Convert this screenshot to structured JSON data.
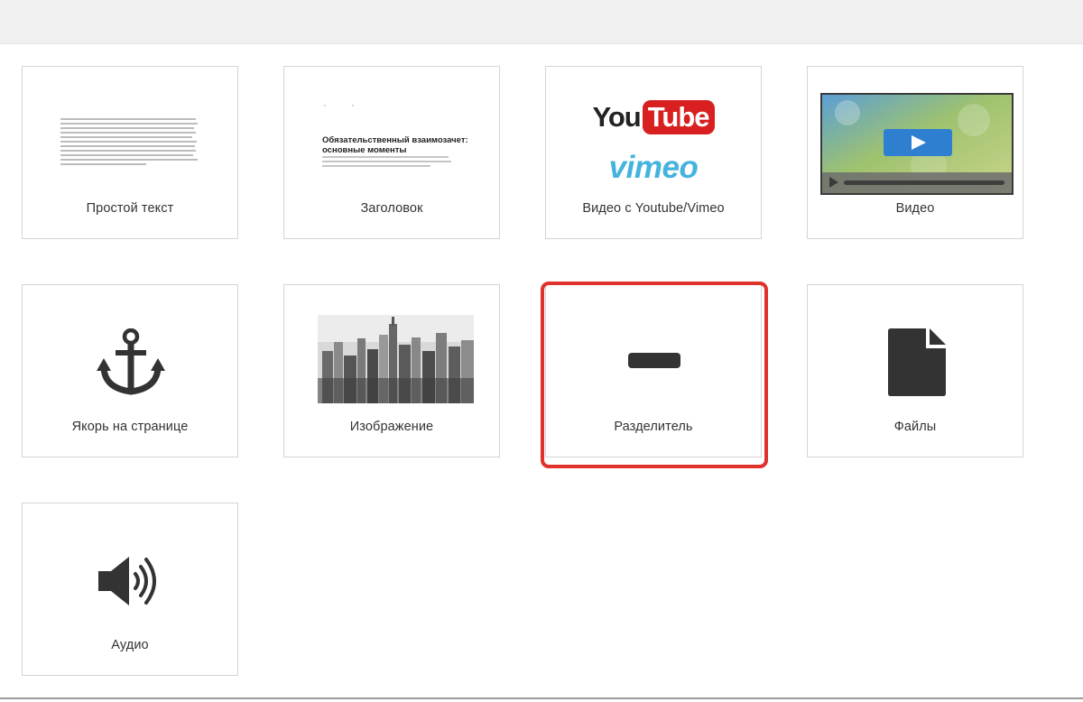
{
  "tiles": [
    {
      "label": "Простой текст"
    },
    {
      "label": "Заголовок"
    },
    {
      "label": "Видео с Youtube/Vimeo"
    },
    {
      "label": "Видео"
    },
    {
      "label": "Якорь на странице"
    },
    {
      "label": "Изображение"
    },
    {
      "label": "Разделитель"
    },
    {
      "label": "Файлы"
    },
    {
      "label": "Аудио"
    }
  ],
  "header_preview": {
    "title": "Обязательственный взаимозачет: основные моменты"
  },
  "video_logos": {
    "you": "You",
    "tube": "Tube",
    "vimeo": "vimeo"
  },
  "selected_tile": "Разделитель",
  "colors": {
    "highlight": "#e0312c",
    "icon": "#333333",
    "youtube_red": "#d7201f",
    "vimeo_blue": "#44b3dd",
    "play_blue": "#2f7fd1"
  },
  "icons": [
    "anchor-icon",
    "divider-icon",
    "file-icon",
    "speaker-icon",
    "play-icon"
  ]
}
